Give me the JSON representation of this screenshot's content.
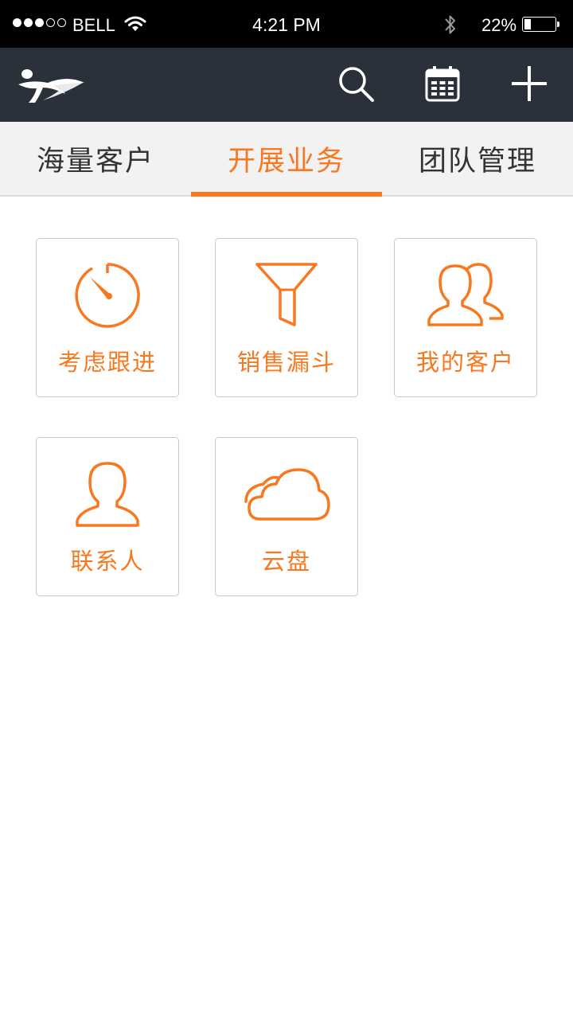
{
  "status_bar": {
    "carrier": "BELL",
    "time": "4:21 PM",
    "battery_percent": "22%",
    "battery_level": 0.22,
    "signal_bars_filled": 3,
    "signal_bars_total": 5
  },
  "header": {
    "logo_icon": "brand-logo-icon",
    "actions": [
      "search-icon",
      "calendar-icon",
      "plus-icon"
    ]
  },
  "tabs": [
    {
      "label": "海量客户",
      "active": false
    },
    {
      "label": "开展业务",
      "active": true
    },
    {
      "label": "团队管理",
      "active": false
    }
  ],
  "tiles": [
    {
      "label": "考虑跟进",
      "icon": "timer-icon"
    },
    {
      "label": "销售漏斗",
      "icon": "funnel-icon"
    },
    {
      "label": "我的客户",
      "icon": "people-icon"
    },
    {
      "label": "联系人",
      "icon": "person-icon"
    },
    {
      "label": "云盘",
      "icon": "cloud-icon"
    }
  ],
  "colors": {
    "accent": "#f7781e",
    "header_bg": "#2b313b",
    "tab_bg": "#f2f2f2",
    "status_bar_bg": "#000000"
  }
}
